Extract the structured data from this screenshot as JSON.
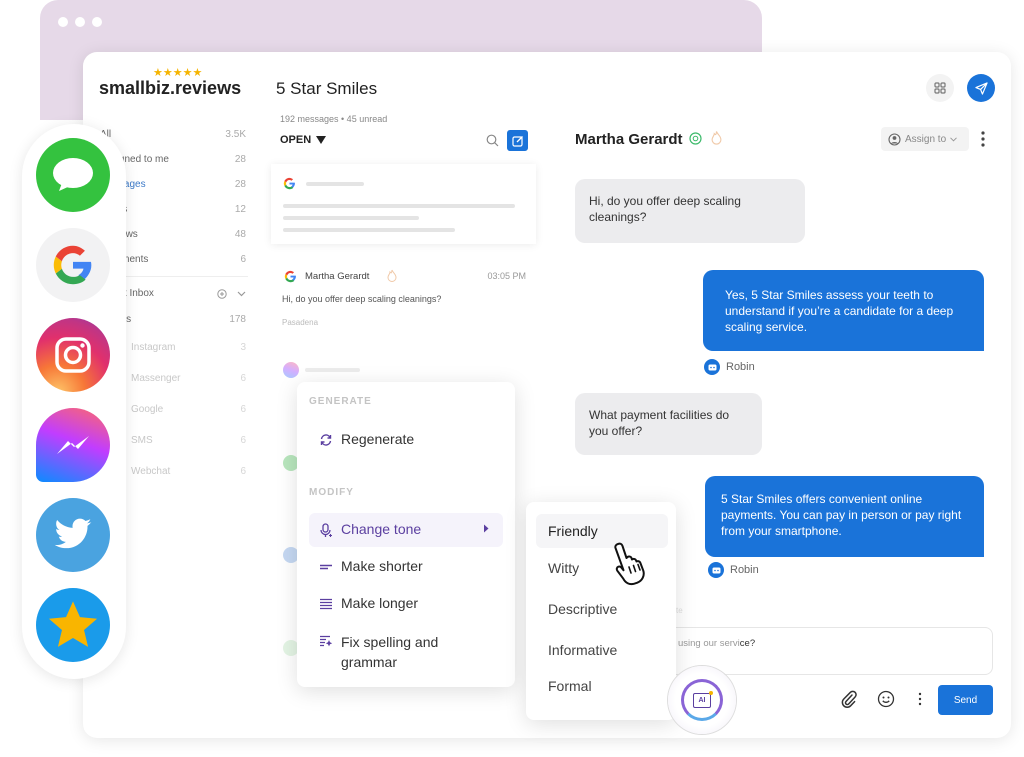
{
  "brand": {
    "logo": "smallbiz.reviews",
    "stars": "★★★★★",
    "business_name": "5 Star Smiles"
  },
  "colors": {
    "primary": "#1a73d9",
    "ai_purple": "#5b3fa0",
    "star": "#f5b400",
    "frame": "#e6d9e8"
  },
  "channels": [
    {
      "name": "iMessage",
      "icon": "imessage-icon"
    },
    {
      "name": "Google",
      "icon": "google-icon"
    },
    {
      "name": "Instagram",
      "icon": "instagram-icon"
    },
    {
      "name": "Messenger",
      "icon": "messenger-icon"
    },
    {
      "name": "Twitter",
      "icon": "twitter-icon"
    },
    {
      "name": "Reviews",
      "icon": "star-icon"
    }
  ],
  "sidebar": {
    "items": [
      {
        "label": "All",
        "count": "3.5K"
      },
      {
        "label": "Assigned to me",
        "count": "28"
      },
      {
        "label": "Messages",
        "count": "28"
      },
      {
        "label": "Leads",
        "count": "12"
      },
      {
        "label": "Reviews",
        "count": "48"
      },
      {
        "label": "Comments",
        "count": "6"
      }
    ],
    "smart_inbox": {
      "label": "Smart Inbox",
      "stages": {
        "label": "Stages",
        "count": "178"
      },
      "sources": [
        {
          "label": "Instagram",
          "count": "3"
        },
        {
          "label": "Massenger",
          "count": "6"
        },
        {
          "label": "Google",
          "count": "6"
        },
        {
          "label": "SMS",
          "count": "6"
        },
        {
          "label": "Webchat",
          "count": "6"
        }
      ]
    }
  },
  "message_list": {
    "meta": "192 messages • 45 unread",
    "filter": "OPEN",
    "conversation": {
      "name": "Martha Gerardt",
      "time": "03:05 PM",
      "preview": "Hi, do you offer deep scaling cleanings?",
      "location": "Pasadena"
    }
  },
  "chat": {
    "contact_name": "Martha Gerardt",
    "assign_label": "Assign to",
    "messages": [
      {
        "direction": "in",
        "text": "Hi, do you offer deep scaling cleanings?"
      },
      {
        "direction": "out",
        "text": "Yes, 5 Star Smiles assess your teeth to understand if you’re a candidate for a deep scaling service.",
        "agent": "Robin"
      },
      {
        "direction": "in",
        "text": "What payment facilities do you offer?"
      },
      {
        "direction": "out",
        "text": "5 Star Smiles offers convenient online payments. You can pay in person or pay right from your smartphone.",
        "agent": "Robin"
      }
    ],
    "composer_prefix": "using our servi",
    "composer_suffix": "ce?",
    "note_label": "te",
    "send_label": "Send",
    "ai_label": "AI"
  },
  "ai_menu": {
    "generate_header": "GENERATE",
    "regenerate": "Regenerate",
    "modify_header": "MODIFY",
    "change_tone": "Change tone",
    "make_shorter": "Make shorter",
    "make_longer": "Make longer",
    "fix_spelling": "Fix spelling and grammar"
  },
  "tone_menu": {
    "options": [
      "Friendly",
      "Witty",
      "Descriptive",
      "Informative",
      "Formal"
    ],
    "hovered": "Friendly"
  }
}
